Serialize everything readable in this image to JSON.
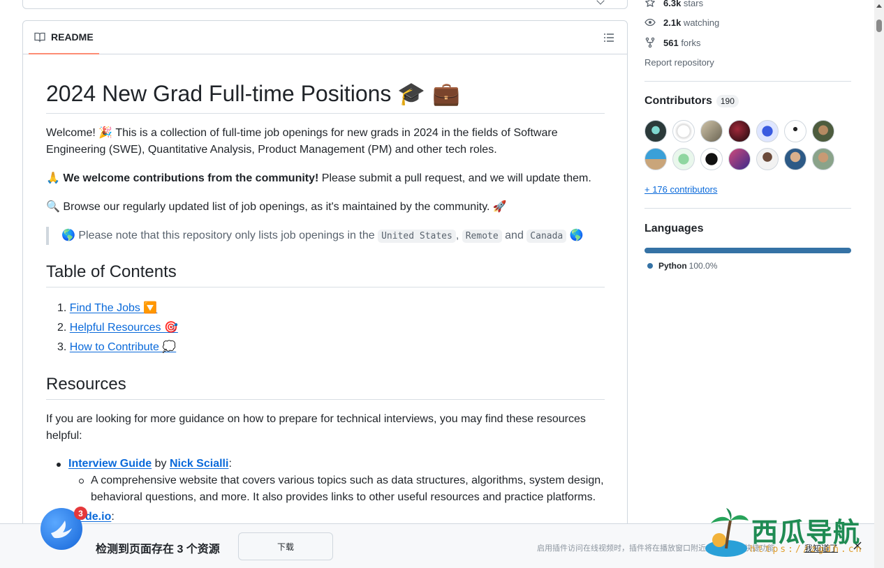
{
  "readme": {
    "tab_label": "README",
    "title": "2024 New Grad Full-time Positions",
    "title_emoji": "🎓 💼",
    "welcome_p1": "Welcome! 🎉 This is a collection of full-time job openings for new grads in 2024 in the fields of Software Engineering (SWE), Quantitative Analysis, Product Management (PM) and other tech roles.",
    "welcome_emoji": "🙏",
    "welcome_bold": "We welcome contributions from the community!",
    "welcome_rest": " Please submit a pull request, and we will update them.",
    "browse_emoji": "🔍",
    "browse_text": " Browse our regularly updated list of job openings, as it's maintained by the community. 🚀",
    "quote_pre": "🌎 Please note that this repository only lists job openings in the",
    "quote_code1": "United States",
    "quote_code2": "Remote",
    "quote_and": "and",
    "quote_code3": "Canada",
    "quote_end": "🌎",
    "toc_title": "Table of Contents",
    "toc": [
      {
        "num": "1.",
        "label": "Find The Jobs 🔽"
      },
      {
        "num": "2.",
        "label": "Helpful Resources 🎯"
      },
      {
        "num": "3.",
        "label": "How to Contribute 💭"
      }
    ],
    "resources_title": "Resources",
    "resources_intro": "If you are looking for more guidance on how to prepare for technical interviews, you may find these resources helpful:",
    "res1_link": "Interview Guide",
    "res1_by": " by ",
    "res1_author": "Nick Scialli",
    "res1_colon": ":",
    "res1_desc": "A comprehensive website that covers various topics such as data structures, algorithms, system design, behavioral questions, and more. It also provides links to other useful resources and practice platforms.",
    "res2_link": "tcode.io",
    "res2_colon": ":"
  },
  "sidebar": {
    "stars": "6.3k",
    "stars_label": " stars",
    "watching": "2.1k",
    "watching_label": " watching",
    "forks": "561",
    "forks_label": " forks",
    "report": "Report repository",
    "contributors_title": "Contributors",
    "contributors_count": "190",
    "more_contributors": "+ 176 contributors",
    "languages_title": "Languages",
    "language_name": "Python",
    "language_pct": "100.0%",
    "language_color": "#3572a5"
  },
  "download_bar": {
    "badge": "3",
    "message": "检测到页面存在 3 个资源",
    "button": "下载",
    "hint": "启用插件访问在线视频时，插件将在播放窗口附近显示链接的快捷功能",
    "ok": "我知道了"
  },
  "watermark": {
    "title": "西瓜导航",
    "url": "https://zgdh.cn"
  }
}
